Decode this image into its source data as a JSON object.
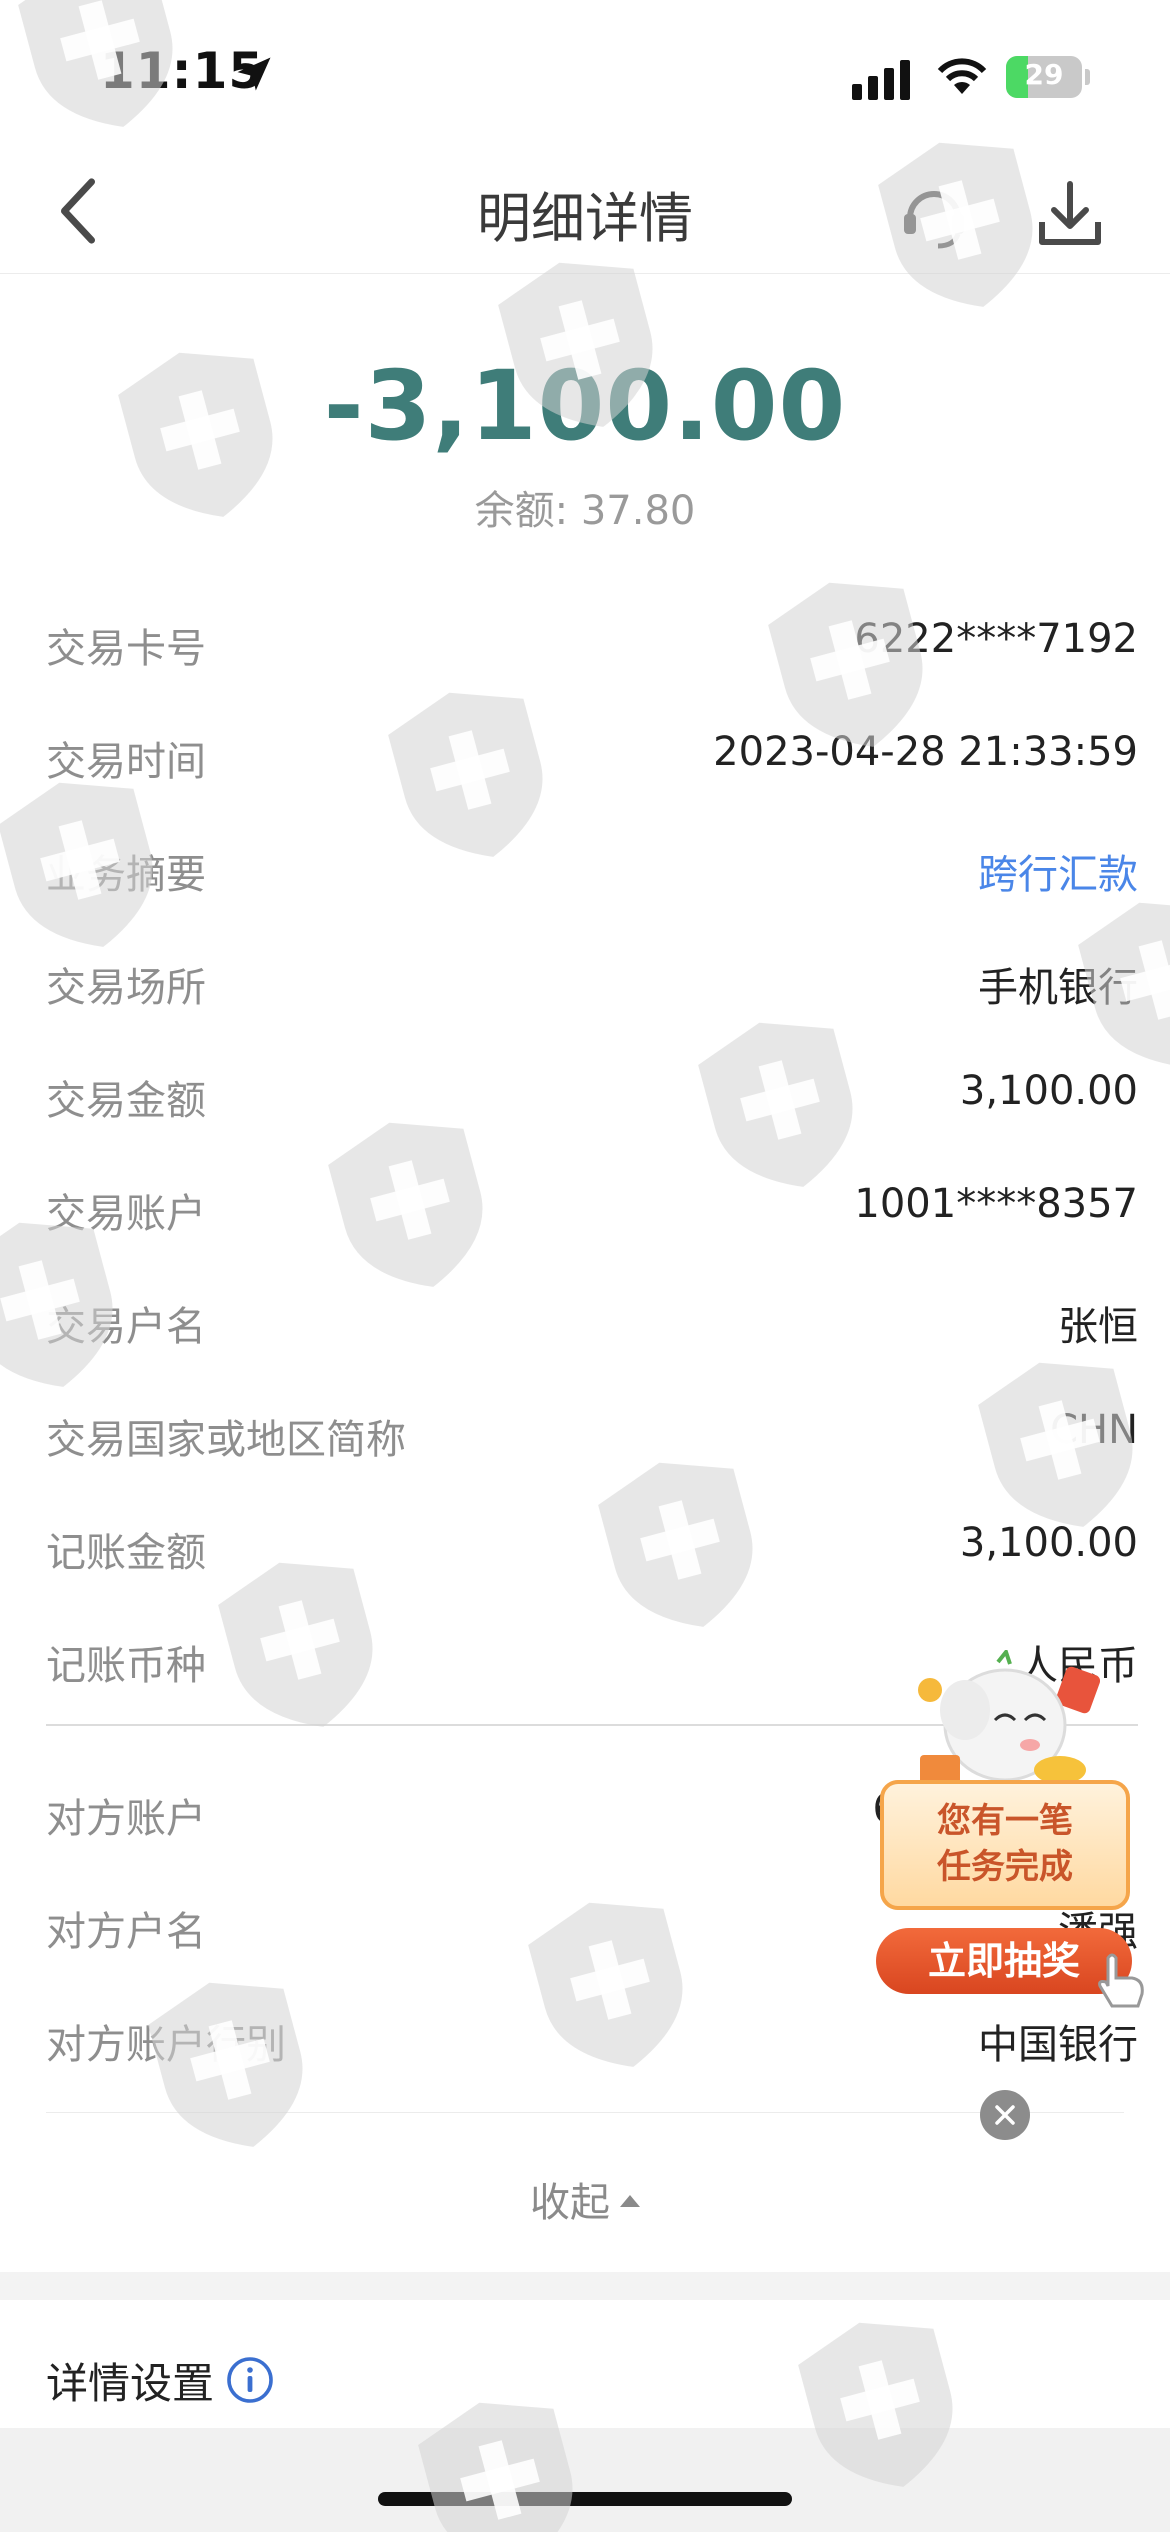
{
  "status_bar": {
    "time": "11:15",
    "battery_text": "29",
    "battery_level": 0.29,
    "icons": [
      "location-arrow-icon",
      "signal-icon",
      "wifi-icon",
      "battery-icon"
    ]
  },
  "nav": {
    "title": "明细详情",
    "icons": [
      "back-chevron-icon",
      "customer-service-headset-icon",
      "download-icon"
    ]
  },
  "summary": {
    "amount": "-3,100.00",
    "balance_label": "余额:",
    "balance_value": "37.80"
  },
  "details": [
    {
      "label": "交易卡号",
      "value": "6222****7192"
    },
    {
      "label": "交易时间",
      "value": "2023-04-28 21:33:59"
    },
    {
      "label": "业务摘要",
      "value": "跨行汇款",
      "link": true
    },
    {
      "label": "交易场所",
      "value": "手机银行"
    },
    {
      "label": "交易金额",
      "value": "3,100.00"
    },
    {
      "label": "交易账户",
      "value": "1001****8357"
    },
    {
      "label": "交易户名",
      "value": "张恒"
    },
    {
      "label": "交易国家或地区简称",
      "value": "CHN"
    },
    {
      "label": "记账金额",
      "value": "3,100.00"
    },
    {
      "label": "记账币种",
      "value": "人民币"
    }
  ],
  "counterparty": [
    {
      "label": "对方账户",
      "value": "6"
    },
    {
      "label": "对方户名",
      "value": "潘强"
    },
    {
      "label": "对方账户行别",
      "value": "中国银行"
    }
  ],
  "collapse_label": "收起",
  "settings_label": "详情设置",
  "promo": {
    "line1": "您有一笔",
    "line2": "任务完成",
    "button": "立即抽奖"
  },
  "colors": {
    "amount": "#3f7d79",
    "link": "#4a86e8",
    "promo_button": "#e2542a",
    "battery_fill": "#4cd964"
  }
}
